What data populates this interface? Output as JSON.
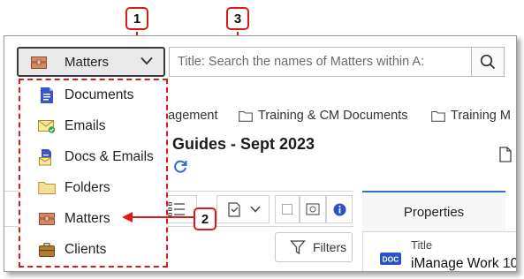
{
  "search": {
    "scope_label": "Matters",
    "placeholder": "Title: Search the names of Matters within A:"
  },
  "breadcrumbs": [
    "nagement",
    "Training & CM Documents",
    "Training M"
  ],
  "page_title": "Guides - Sept 2023",
  "toolbar": {
    "filters_label": "Filters"
  },
  "properties": {
    "tab_label": "Properties",
    "title_label": "Title",
    "title_value": "iManage Work 10",
    "doc_badge": "DOC"
  },
  "scope_menu": {
    "items": [
      {
        "label": "Documents",
        "icon": "documents-icon",
        "color": "#3a55c9"
      },
      {
        "label": "Emails",
        "icon": "email-icon",
        "color": "#e3b93c"
      },
      {
        "label": "Docs & Emails",
        "icon": "docs-emails-icon",
        "color": "#3a55c9"
      },
      {
        "label": "Folders",
        "icon": "folder-icon",
        "color": "#f2d98c"
      },
      {
        "label": "Matters",
        "icon": "matter-icon",
        "color": "#c87a55"
      },
      {
        "label": "Clients",
        "icon": "client-icon",
        "color": "#a8722c"
      }
    ]
  },
  "callouts": {
    "one": "1",
    "two": "2",
    "three": "3"
  },
  "colors": {
    "highlight": "#e01818",
    "accent": "#2f6fce"
  }
}
